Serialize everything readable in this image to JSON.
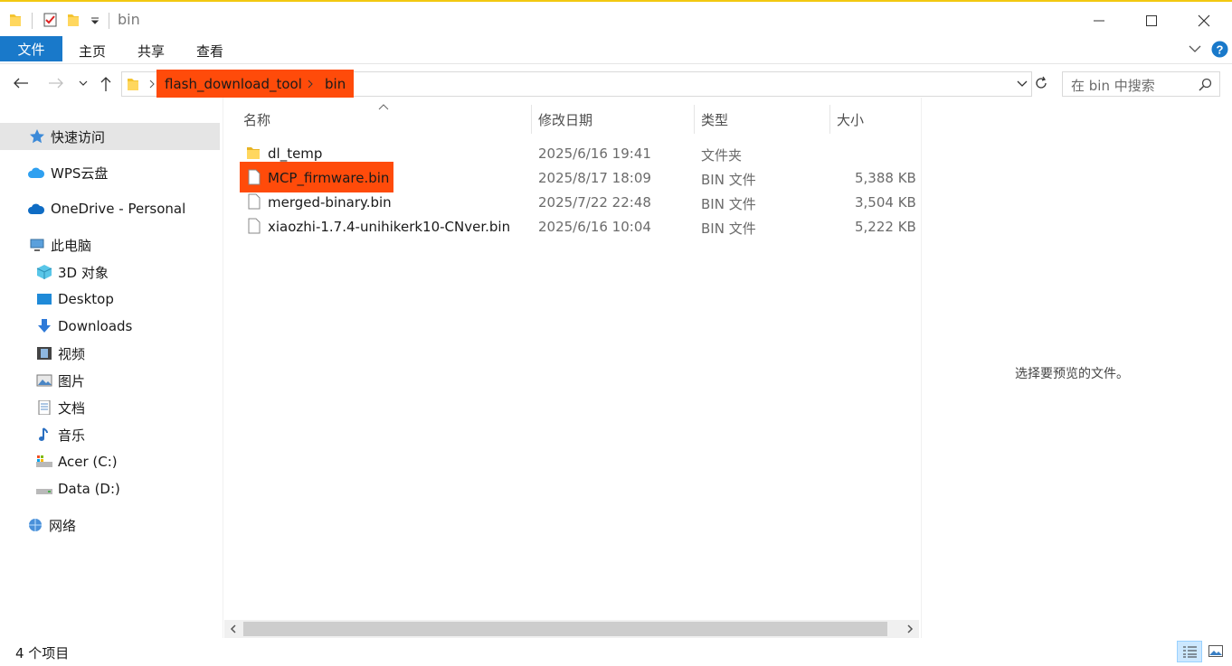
{
  "window": {
    "title": "bin",
    "colors": {
      "accent": "#1979ca",
      "highlight": "#ff4b0a",
      "title_strip": "#f2c811"
    }
  },
  "ribbon": {
    "tabs": [
      {
        "label": "文件"
      },
      {
        "label": "主页"
      },
      {
        "label": "共享"
      },
      {
        "label": "查看"
      }
    ]
  },
  "address": {
    "crumbs": [
      "flash_download_tool",
      "bin"
    ]
  },
  "search": {
    "placeholder": "在 bin 中搜索"
  },
  "sidebar": {
    "items": [
      {
        "label": "快速访问",
        "icon": "star-icon"
      },
      {
        "label": "WPS云盘",
        "icon": "cloud-icon"
      },
      {
        "label": "OneDrive - Personal",
        "icon": "onedrive-icon"
      },
      {
        "label": "此电脑",
        "icon": "computer-icon"
      },
      {
        "label": "3D 对象",
        "icon": "cube-icon"
      },
      {
        "label": "Desktop",
        "icon": "desktop-icon"
      },
      {
        "label": "Downloads",
        "icon": "download-icon"
      },
      {
        "label": "视频",
        "icon": "video-icon"
      },
      {
        "label": "图片",
        "icon": "picture-icon"
      },
      {
        "label": "文档",
        "icon": "document-icon"
      },
      {
        "label": "音乐",
        "icon": "music-icon"
      },
      {
        "label": "Acer (C:)",
        "icon": "drive-c-icon"
      },
      {
        "label": "Data (D:)",
        "icon": "drive-d-icon"
      },
      {
        "label": "网络",
        "icon": "network-icon"
      }
    ]
  },
  "columns": {
    "name": "名称",
    "date": "修改日期",
    "type": "类型",
    "size": "大小"
  },
  "files": [
    {
      "name": "dl_temp",
      "date": "2025/6/16 19:41",
      "type": "文件夹",
      "size": "",
      "icon": "folder-icon"
    },
    {
      "name": "MCP_firmware.bin",
      "date": "2025/8/17 18:09",
      "type": "BIN 文件",
      "size": "5,388 KB",
      "icon": "file-icon"
    },
    {
      "name": "merged-binary.bin",
      "date": "2025/7/22 22:48",
      "type": "BIN 文件",
      "size": "3,504 KB",
      "icon": "file-icon"
    },
    {
      "name": "xiaozhi-1.7.4-unihikerk10-CNver.bin",
      "date": "2025/6/16 10:04",
      "type": "BIN 文件",
      "size": "5,222 KB",
      "icon": "file-icon"
    }
  ],
  "preview": {
    "text": "选择要预览的文件。"
  },
  "status": {
    "count": "4 个项目"
  }
}
